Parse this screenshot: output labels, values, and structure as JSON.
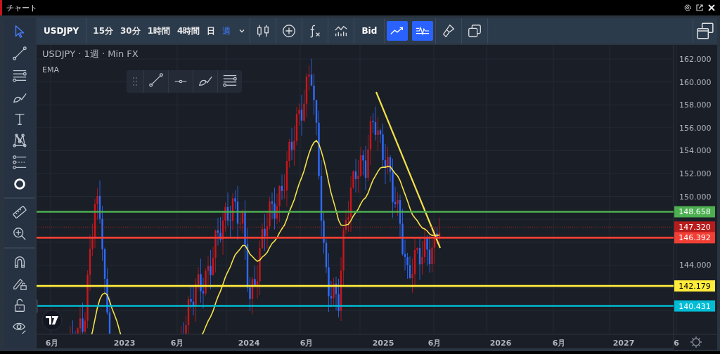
{
  "window": {
    "title": "チャート"
  },
  "toolbar": {
    "symbol": "USDJPY",
    "intervals": [
      {
        "label": "15分",
        "selected": false
      },
      {
        "label": "30分",
        "selected": false
      },
      {
        "label": "1時間",
        "selected": false
      },
      {
        "label": "4時間",
        "selected": false
      },
      {
        "label": "日",
        "selected": false
      },
      {
        "label": "週",
        "selected": true
      }
    ],
    "price_source": "Bid",
    "toggles": [
      {
        "kind": "trend",
        "on": true
      },
      {
        "kind": "wave",
        "on": true
      }
    ]
  },
  "left_tools": [
    [
      {
        "kind": "cursor",
        "selected": true
      },
      {
        "kind": "line",
        "selected": false
      },
      {
        "kind": "hlines",
        "selected": false
      },
      {
        "kind": "brush",
        "selected": false
      },
      {
        "kind": "text",
        "selected": false
      },
      {
        "kind": "pattern",
        "selected": false
      },
      {
        "kind": "fib",
        "selected": false
      },
      {
        "kind": "circle",
        "selected": false
      }
    ],
    [
      {
        "kind": "ruler",
        "selected": false
      },
      {
        "kind": "zoom",
        "selected": false
      }
    ],
    [
      {
        "kind": "magnet",
        "selected": false
      },
      {
        "kind": "pencil-lock",
        "selected": false
      },
      {
        "kind": "lock",
        "selected": false
      },
      {
        "kind": "eye",
        "selected": false
      }
    ]
  ],
  "legend": {
    "title": "USDJPY · 1週 · Min FX",
    "indicator": "EMA"
  },
  "price_axis": {
    "ticks": [
      "162.000",
      "160.000",
      "158.000",
      "156.000",
      "154.000",
      "152.000",
      "150.000",
      "144.000"
    ]
  },
  "price_lines": [
    {
      "price": "148.658",
      "kind": "level",
      "color": "#4caf50"
    },
    {
      "price": "147.320",
      "kind": "current",
      "color": "#b71c1c"
    },
    {
      "price": "146.392",
      "kind": "level",
      "color": "#f23f35"
    },
    {
      "price": "142.179",
      "kind": "level",
      "color": "#ffeb3b"
    },
    {
      "price": "140.431",
      "kind": "level",
      "color": "#00bcd4"
    }
  ],
  "time_axis": {
    "labels": [
      "6月",
      "2023",
      "6月",
      "2024",
      "6月",
      "2025",
      "6月",
      "2026",
      "6月",
      "2027",
      "6"
    ]
  }
}
